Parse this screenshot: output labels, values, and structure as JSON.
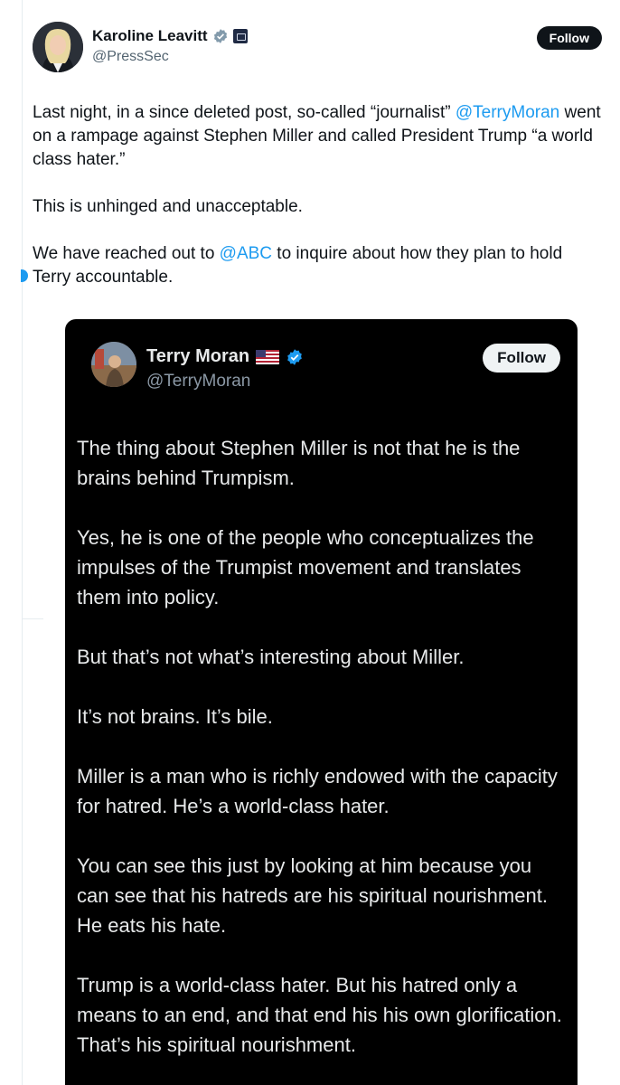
{
  "tweet": {
    "author": {
      "display_name": "Karoline Leavitt",
      "handle": "@PressSec"
    },
    "follow_label": "Follow",
    "body": {
      "p1_prefix": "Last night, in a since deleted post, so-called “journalist” ",
      "p1_mention": "@TerryMoran",
      "p1_suffix": " went on a rampage against Stephen Miller and called President Trump “a world class hater.”",
      "p2": "This is unhinged and unacceptable.",
      "p3_prefix": "We have reached out to ",
      "p3_mention": "@ABC",
      "p3_suffix": " to inquire about how they plan to hold Terry accountable."
    }
  },
  "embedded_post": {
    "author": {
      "display_name": "Terry Moran",
      "handle": "@TerryMoran"
    },
    "follow_label": "Follow",
    "paragraphs": [
      "The thing about Stephen Miller is not that he is the brains behind Trumpism.",
      "Yes, he is one of the people who conceptualizes the impulses of the Trumpist movement and translates them into policy.",
      "But that’s not what’s interesting about Miller.",
      "It’s not brains. It’s bile.",
      "Miller is a man who is richly endowed with the capacity for hatred. He’s a world-class hater.",
      "You can see this just by looking at him because you can see that his hatreds are his spiritual nourishment. He eats his hate.",
      "Trump is a world-class hater. But his hatred only a means to an end, and that end his his own glorification. That’s his spiritual nourishment."
    ]
  },
  "colors": {
    "link": "#1d9bf0",
    "text_primary": "#0f1419",
    "text_secondary": "#536471",
    "embed_bg": "#000000",
    "verified_blue": "#1d9bf0",
    "verified_gray": "#829aab"
  },
  "icons": [
    "gray-verified-badge-icon",
    "government-seal-icon",
    "blue-verified-badge-icon",
    "us-flag-icon"
  ]
}
